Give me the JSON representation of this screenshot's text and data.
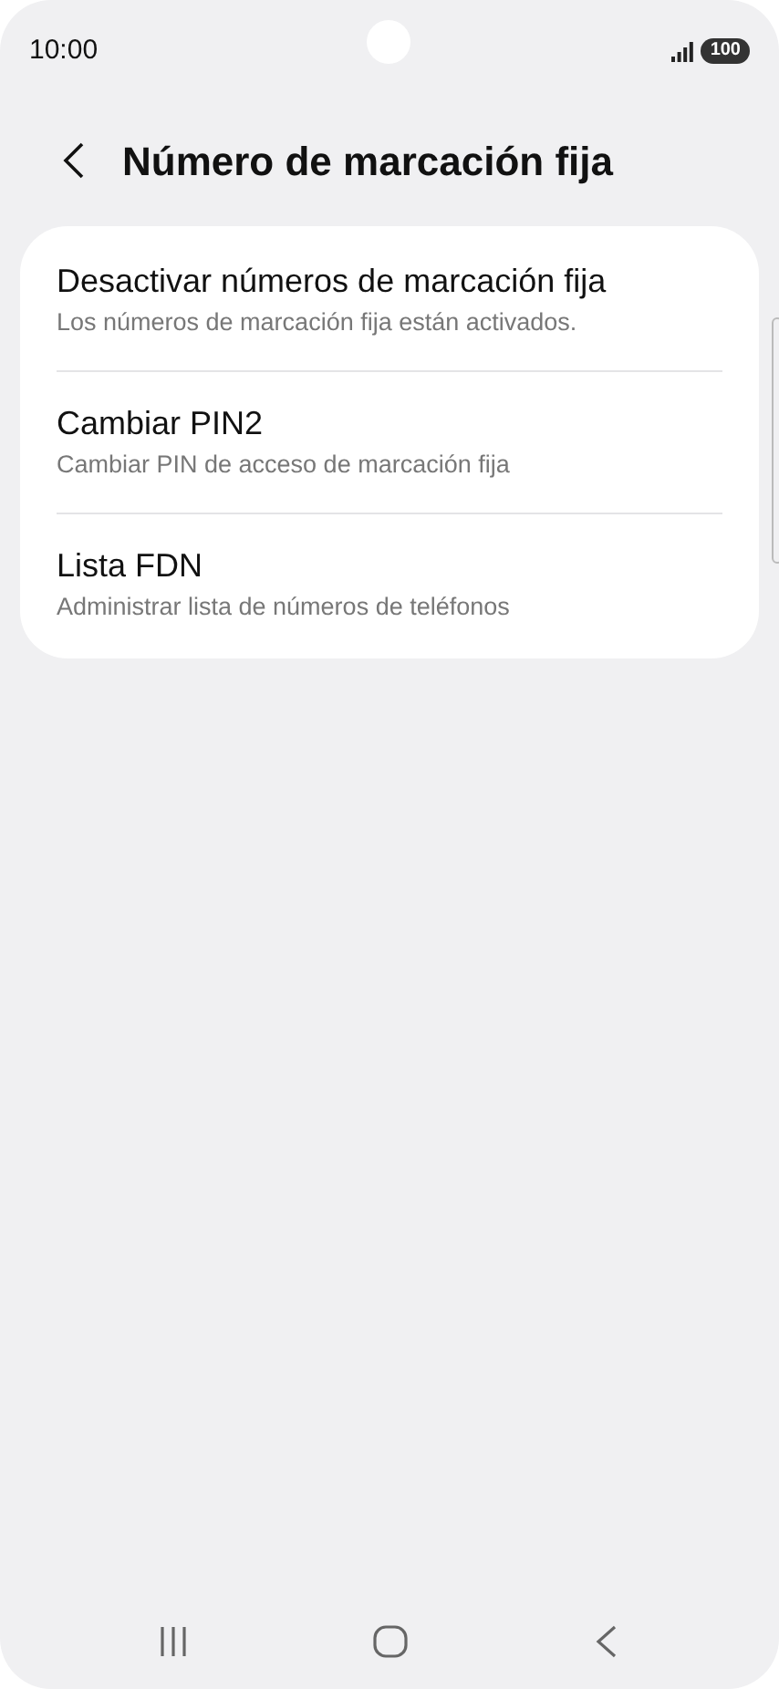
{
  "status_bar": {
    "time": "10:00",
    "battery": "100"
  },
  "header": {
    "title": "Número de marcación fija"
  },
  "items": [
    {
      "title": "Desactivar números de marcación fija",
      "subtitle": "Los números de marcación fija están activados."
    },
    {
      "title": "Cambiar PIN2",
      "subtitle": "Cambiar PIN de acceso de marcación fija"
    },
    {
      "title": "Lista FDN",
      "subtitle": "Administrar lista de números de teléfonos"
    }
  ]
}
